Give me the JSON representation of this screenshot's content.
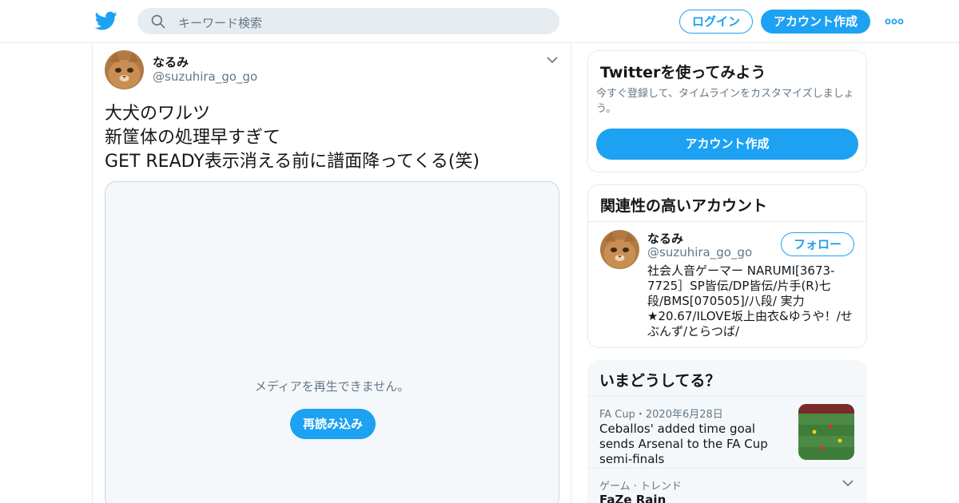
{
  "header": {
    "logo_icon": "twitter-bird-icon",
    "search_placeholder": "キーワード検索",
    "login_label": "ログイン",
    "signup_label": "アカウント作成",
    "more_icon": "more-dots-icon",
    "brand_color": "#1da1f2"
  },
  "tweet": {
    "author_name": "なるみ",
    "author_handle": "@suzuhira_go_go",
    "text_lines": [
      "大犬のワルツ",
      "新筐体の処理早すぎて",
      "GET READY表示消える前に譜面降ってくる(笑)"
    ],
    "media_message": "メディアを再生できません。",
    "reload_label": "再読み込み"
  },
  "sidebar": {
    "signup_card": {
      "title": "Twitterを使ってみよう",
      "description": "今すぐ登録して、タイムラインをカスタマイズしましょう。",
      "button_label": "アカウント作成"
    },
    "related_card": {
      "title": "関連性の高いアカウント",
      "name": "なるみ",
      "handle": "@suzuhira_go_go",
      "follow_label": "フォロー",
      "bio_lines": [
        "社会人音ゲーマー NARUMI[3673-",
        "7725］SP皆伝/DP皆伝/片手(R)七",
        "段/BMS[070505]/八段/ 実力",
        "★20.67/ILOVE坂上由衣&ゆうや！/せ",
        "ぶんず/とらつば/"
      ]
    },
    "trends_card": {
      "title": "いまどうしてる？",
      "items": [
        {
          "meta": "FA Cup・2020年6月28日",
          "headline": "Ceballos' added time goal sends Arsenal to the FA Cup semi-finals"
        },
        {
          "meta": "ゲーム · トレンド",
          "headline": "FaZe Rain"
        }
      ]
    }
  }
}
